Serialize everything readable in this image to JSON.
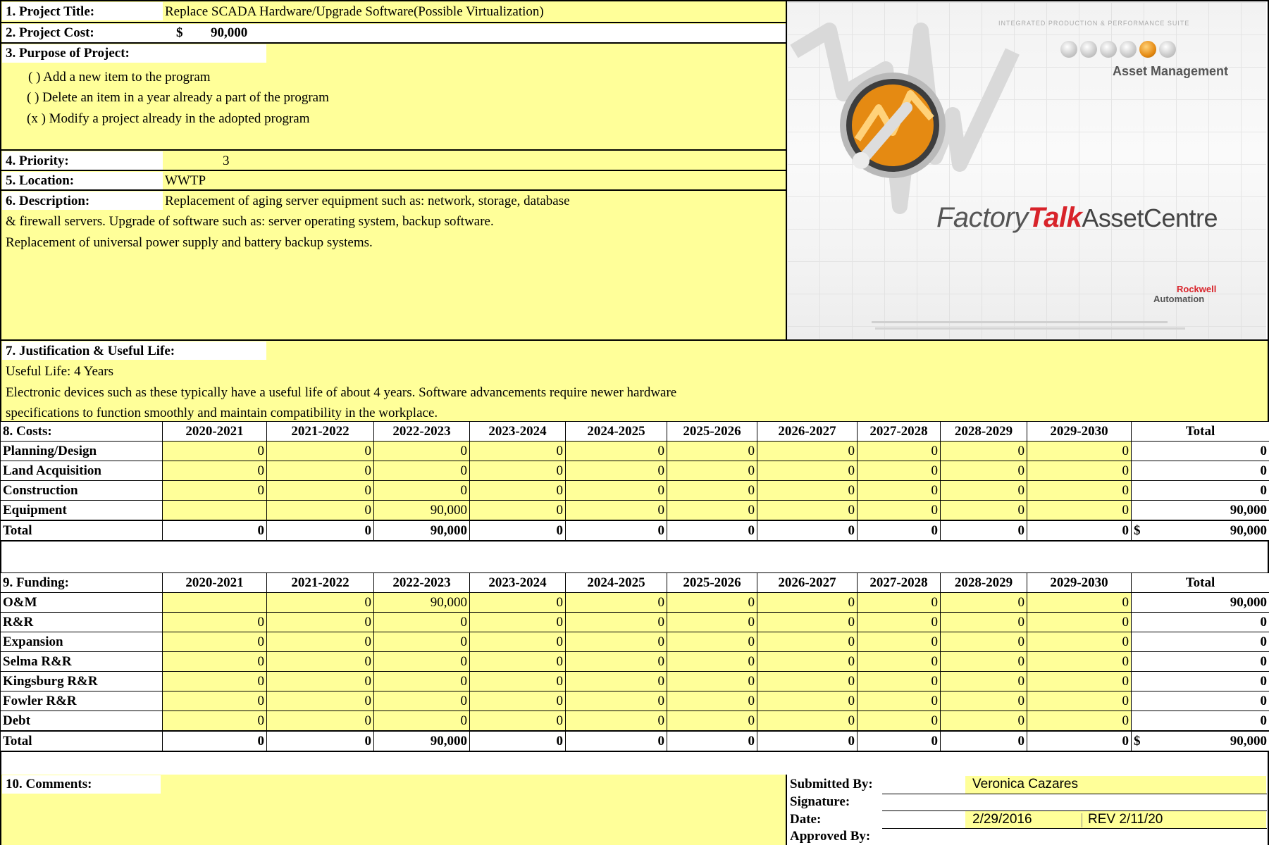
{
  "form": {
    "project_title_label": "1. Project Title:",
    "project_title_value": "Replace SCADA Hardware/Upgrade Software(Possible Virtualization)",
    "project_cost_label": "2. Project Cost:",
    "project_cost_currency": "$",
    "project_cost_value": "90,000",
    "purpose_label": "3. Purpose of Project:",
    "purpose_options": [
      "( ) Add a new item to the program",
      "( ) Delete an item in a year already a part of the program",
      "(x ) Modify a project already in the adopted program"
    ],
    "priority_label": "4. Priority:",
    "priority_value": "3",
    "location_label": "5. Location:",
    "location_value": "WWTP",
    "description_label": "6. Description:",
    "description_lines": [
      "Replacement of aging server equipment such as:  network, storage, database",
      "& firewall servers.     Upgrade of software such as: server operating system, backup software.",
      "Replacement of universal power supply and battery backup systems."
    ],
    "justification_label": "7. Justification & Useful Life:",
    "justification_lines": [
      "Useful Life:  4 Years",
      "Electronic devices such as these typically have a useful life of about 4 years.  Software advancements require newer hardware",
      "specifications to function smoothly and maintain compatibility in the workplace."
    ],
    "comments_label": "10. Comments:",
    "submitted_by_label": "Submitted By:",
    "submitted_by_value": "Veronica Cazares",
    "signature_label": "Signature:",
    "date_label": "Date:",
    "date_value": "2/29/2016",
    "rev_value": "REV 2/11/20",
    "approved_by_label": "Approved By:"
  },
  "logo": {
    "suite_text": "INTEGRATED PRODUCTION & PERFORMANCE SUITE",
    "module": "Asset Management",
    "brand_factory": "Factory",
    "brand_talk": "Talk",
    "brand_product": "AssetCentre",
    "vendor_line1": "Rockwell",
    "vendor_line2": "Automation"
  },
  "costs": {
    "title": "8. Costs:",
    "years": [
      "2020-2021",
      "2021-2022",
      "2022-2023",
      "2023-2024",
      "2024-2025",
      "2025-2026",
      "2026-2027",
      "2027-2028",
      "2028-2029",
      "2029-2030"
    ],
    "total_header": "Total",
    "rows": [
      {
        "label": "Planning/Design",
        "values": [
          "0",
          "0",
          "0",
          "0",
          "0",
          "0",
          "0",
          "0",
          "0",
          "0"
        ],
        "total": "0"
      },
      {
        "label": "Land Acquisition",
        "values": [
          "0",
          "0",
          "0",
          "0",
          "0",
          "0",
          "0",
          "0",
          "0",
          "0"
        ],
        "total": "0"
      },
      {
        "label": "Construction",
        "values": [
          "0",
          "0",
          "0",
          "0",
          "0",
          "0",
          "0",
          "0",
          "0",
          "0"
        ],
        "total": "0"
      },
      {
        "label": "Equipment",
        "values": [
          "",
          "0",
          "90,000",
          "0",
          "0",
          "0",
          "0",
          "0",
          "0",
          "0"
        ],
        "total": "90,000"
      }
    ],
    "total_row": {
      "label": "Total",
      "values": [
        "0",
        "0",
        "90,000",
        "0",
        "0",
        "0",
        "0",
        "0",
        "0",
        "0"
      ],
      "currency": "$",
      "total": "90,000"
    }
  },
  "funding": {
    "title": "9. Funding:",
    "years": [
      "2020-2021",
      "2021-2022",
      "2022-2023",
      "2023-2024",
      "2024-2025",
      "2025-2026",
      "2026-2027",
      "2027-2028",
      "2028-2029",
      "2029-2030"
    ],
    "total_header": "Total",
    "rows": [
      {
        "label": "O&M",
        "values": [
          "",
          "0",
          "90,000",
          "0",
          "0",
          "0",
          "0",
          "0",
          "0",
          "0"
        ],
        "total": "90,000"
      },
      {
        "label": "R&R",
        "values": [
          "0",
          "0",
          "0",
          "0",
          "0",
          "0",
          "0",
          "0",
          "0",
          "0"
        ],
        "total": "0"
      },
      {
        "label": "Expansion",
        "values": [
          "0",
          "0",
          "0",
          "0",
          "0",
          "0",
          "0",
          "0",
          "0",
          "0"
        ],
        "total": "0"
      },
      {
        "label": "Selma R&R",
        "values": [
          "0",
          "0",
          "0",
          "0",
          "0",
          "0",
          "0",
          "0",
          "0",
          "0"
        ],
        "total": "0"
      },
      {
        "label": "Kingsburg R&R",
        "values": [
          "0",
          "0",
          "0",
          "0",
          "0",
          "0",
          "0",
          "0",
          "0",
          "0"
        ],
        "total": "0"
      },
      {
        "label": "Fowler R&R",
        "values": [
          "0",
          "0",
          "0",
          "0",
          "0",
          "0",
          "0",
          "0",
          "0",
          "0"
        ],
        "total": "0"
      },
      {
        "label": "Debt",
        "values": [
          "0",
          "0",
          "0",
          "0",
          "0",
          "0",
          "0",
          "0",
          "0",
          "0"
        ],
        "total": "0"
      }
    ],
    "total_row": {
      "label": "Total",
      "values": [
        "0",
        "0",
        "90,000",
        "0",
        "0",
        "0",
        "0",
        "0",
        "0",
        "0"
      ],
      "currency": "$",
      "total": "90,000"
    }
  },
  "colors": {
    "highlight": "#ffff99",
    "border": "#000000",
    "brand_red": "#d8232a"
  }
}
